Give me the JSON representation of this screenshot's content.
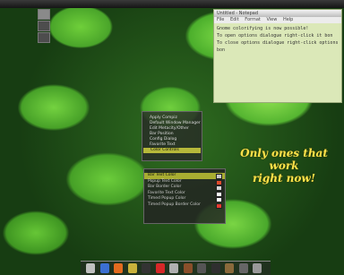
{
  "topbar": {
    "right_text": ""
  },
  "pager": {
    "workspaces": 3
  },
  "editor": {
    "title": "Untitled - Notepad",
    "menu": [
      "File",
      "Edit",
      "Format",
      "View",
      "Help"
    ],
    "lines": [
      "Gnome colorifying is now possible!",
      "To open options dialogue right-click it bon",
      "To close options dialogue right-click options bon"
    ]
  },
  "ccsm_menu": {
    "items": [
      "Apply Compiz",
      "Default Window Manager",
      "Edit Metacity/Other",
      "Bar Position",
      "Config Dialog",
      "Favorite Text",
      "Color Controls"
    ],
    "selected_index": 6
  },
  "color_panel": {
    "items": [
      {
        "label": "Bar Text Color",
        "color": "#c8c8c8"
      },
      {
        "label": "Popup Text Color",
        "color": "#e04b2b"
      },
      {
        "label": "Bar Border Color",
        "color": "#d7d7d7"
      },
      {
        "label": "Favorite Text Color",
        "color": "#ffffff"
      },
      {
        "label": "Timed Popup Color",
        "color": "#ffffff"
      },
      {
        "label": "Timed Popup Border Color",
        "color": "#e63c30"
      }
    ],
    "selected_index": 0
  },
  "annotation": {
    "line1": "Only ones that work",
    "line2": "right now!"
  },
  "dock": {
    "icons": [
      {
        "name": "folder-icon",
        "color": "#c0c0c0"
      },
      {
        "name": "globe-icon",
        "color": "#3b6fd1"
      },
      {
        "name": "firefox-icon",
        "color": "#e36b1f"
      },
      {
        "name": "email-icon",
        "color": "#c9b23b"
      },
      {
        "name": "terminal-icon",
        "color": "#333333"
      },
      {
        "name": "music-icon",
        "color": "#d62828"
      },
      {
        "name": "search-icon",
        "color": "#b0b0b0"
      },
      {
        "name": "photo-icon",
        "color": "#8a4f2a"
      },
      {
        "name": "image-viewer-icon",
        "color": "#555555"
      },
      {
        "name": "phone-icon",
        "color": "#2f2f2f"
      },
      {
        "name": "tools-icon",
        "color": "#8a6a3b"
      },
      {
        "name": "monitor-icon",
        "color": "#666666"
      },
      {
        "name": "trash-icon",
        "color": "#999999"
      }
    ]
  }
}
